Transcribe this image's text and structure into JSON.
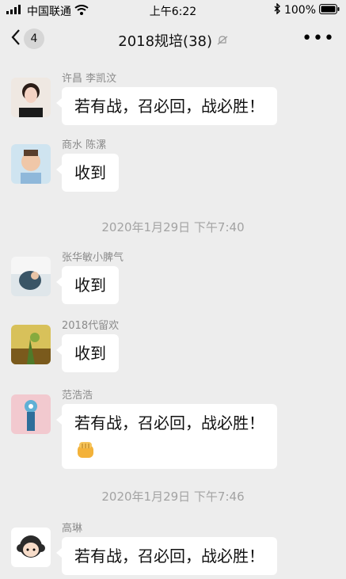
{
  "status": {
    "carrier": "中国联通",
    "time": "上午6:22",
    "battery": "100%"
  },
  "nav": {
    "back_badge": "4",
    "title": "2018规培(38)"
  },
  "messages": [
    {
      "sender": "许昌  李凯汶",
      "text": "若有战，召必回，战必胜！",
      "avatar": "avatar-woman"
    },
    {
      "sender": "商水  陈漯",
      "text": "收到",
      "avatar": "avatar-child"
    },
    {
      "sender": "张华敏小脾气",
      "text": "收到",
      "avatar": "avatar-photo"
    },
    {
      "sender": "2018代留欢",
      "text": "收到",
      "avatar": "avatar-plant"
    },
    {
      "sender": "范浩浩",
      "text": "若有战，召必回，战必胜！",
      "emoji": "fist-emoji",
      "avatar": "avatar-cartoon"
    },
    {
      "sender": "高琳",
      "text": "若有战，召必回，战必胜！",
      "avatar": "avatar-girl-cartoon"
    }
  ],
  "timestamps": [
    "2020年1月29日  下午7:40",
    "2020年1月29日  下午7:46"
  ]
}
